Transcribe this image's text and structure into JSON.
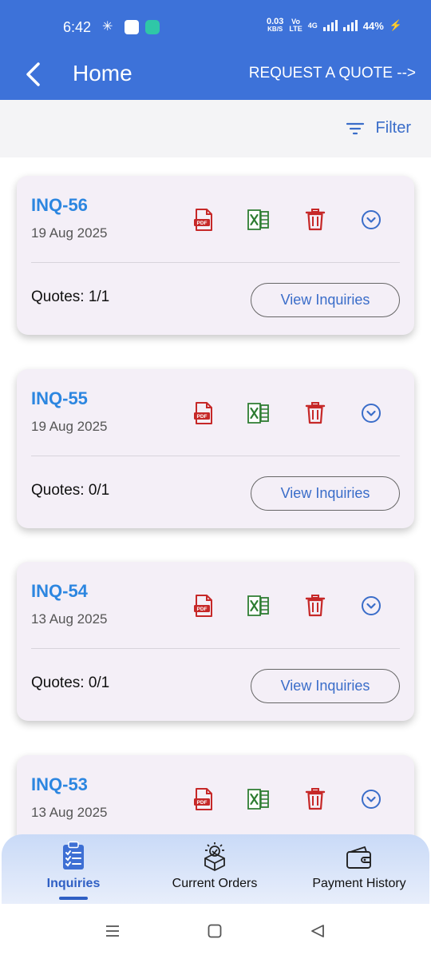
{
  "status_bar": {
    "time": "6:42",
    "speed_value": "0.03",
    "speed_unit": "KB/S",
    "volte_top": "Vo",
    "volte_bottom": "LTE",
    "network": "4G",
    "battery": "44%"
  },
  "app_bar": {
    "title": "Home",
    "request_quote": "REQUEST A QUOTE -->"
  },
  "filter": {
    "label": "Filter"
  },
  "inquiries": [
    {
      "id": "INQ-56",
      "date": "19 Aug 2025",
      "quotes": "Quotes: 1/1",
      "action": "View Inquiries"
    },
    {
      "id": "INQ-55",
      "date": "19 Aug 2025",
      "quotes": "Quotes: 0/1",
      "action": "View Inquiries"
    },
    {
      "id": "INQ-54",
      "date": "13 Aug 2025",
      "quotes": "Quotes: 0/1",
      "action": "View Inquiries"
    },
    {
      "id": "INQ-53",
      "date": "13 Aug 2025",
      "quotes": "",
      "action": ""
    }
  ],
  "card_icons": [
    "pdf-icon",
    "excel-icon",
    "delete-icon",
    "expand-icon"
  ],
  "bottom_nav": {
    "items": [
      {
        "label": "Inquiries",
        "icon": "clipboard-list-icon",
        "active": true
      },
      {
        "label": "Current Orders",
        "icon": "box-check-icon",
        "active": false
      },
      {
        "label": "Payment History",
        "icon": "wallet-icon",
        "active": false
      }
    ]
  },
  "colors": {
    "primary": "#3d72d9",
    "accent_text": "#2c86e0",
    "pdf_red": "#c62828",
    "excel_green": "#2e7d32",
    "card_bg": "#f4eff7"
  }
}
